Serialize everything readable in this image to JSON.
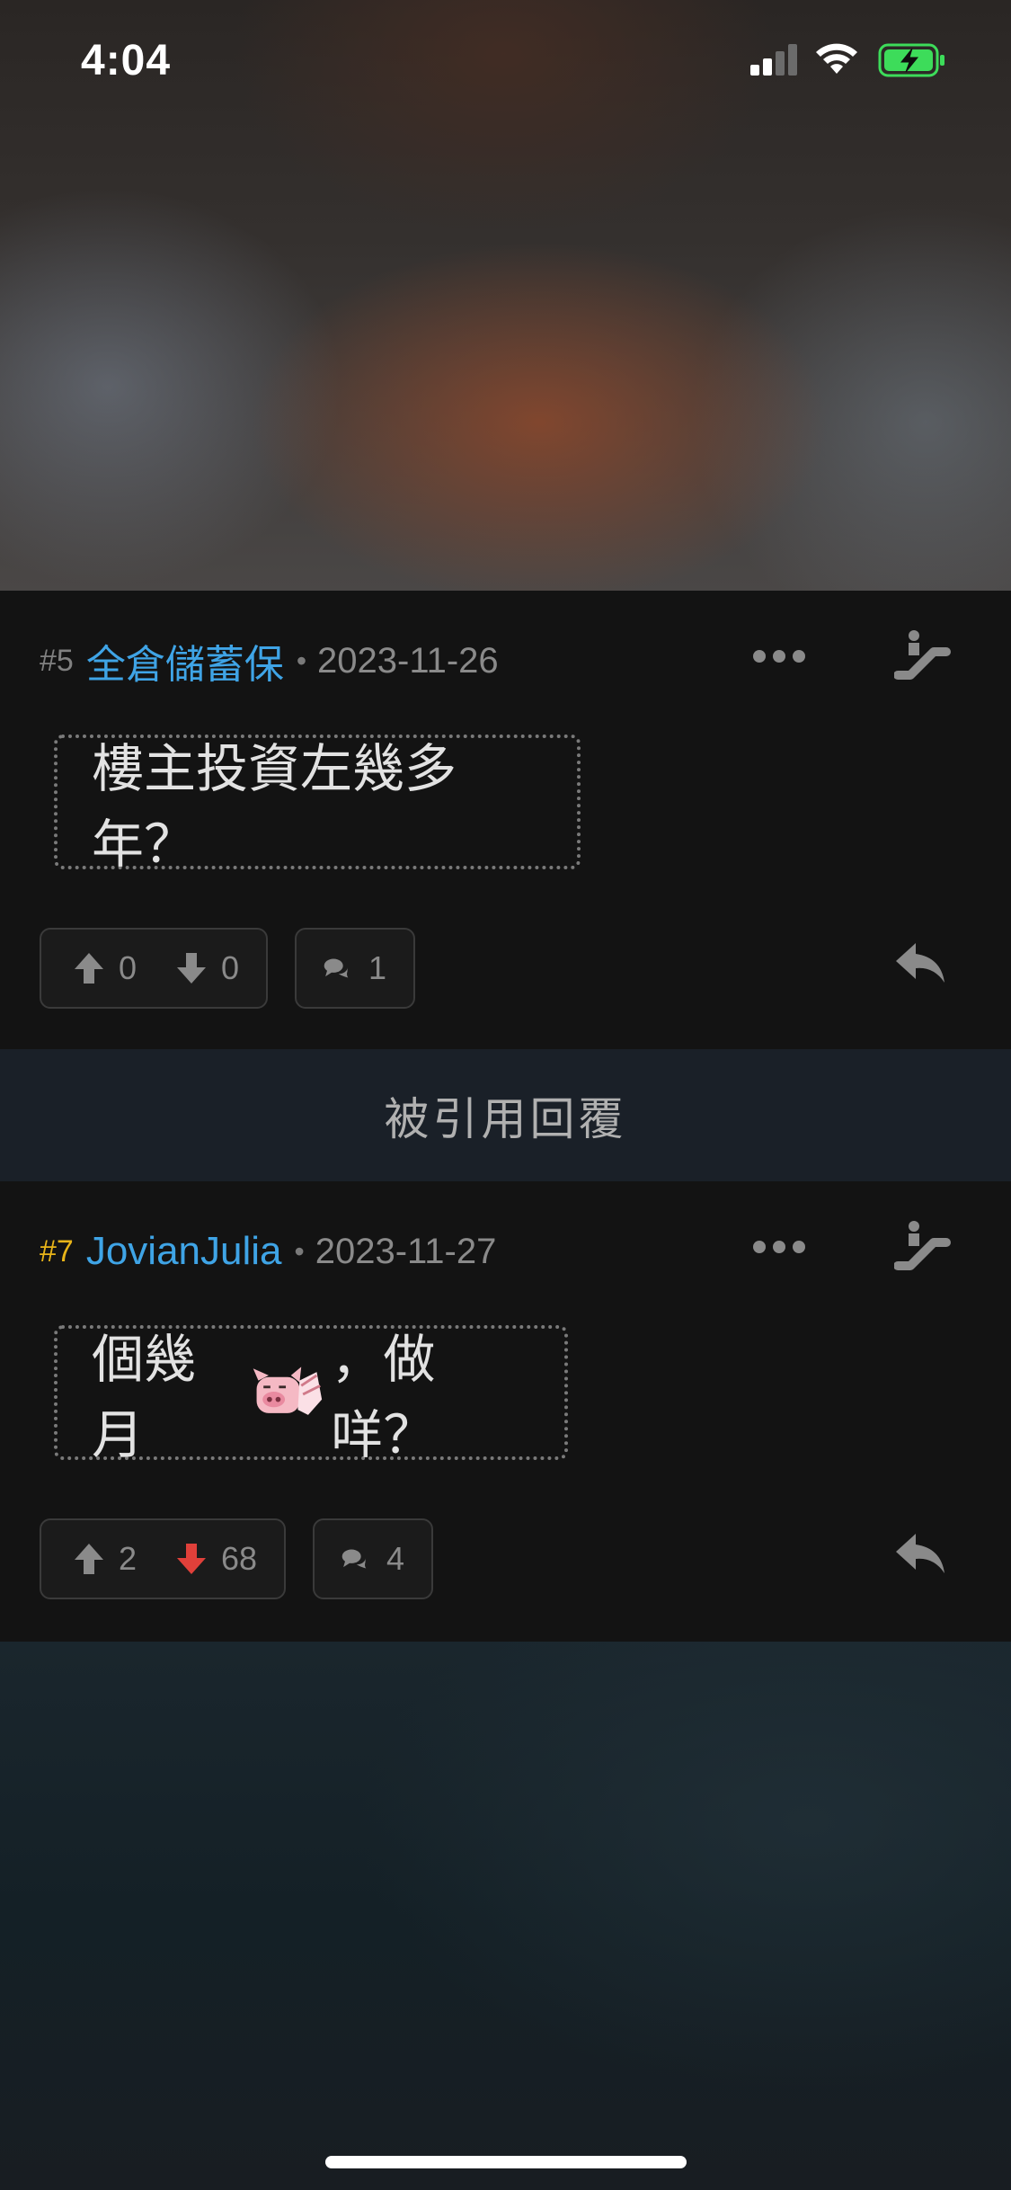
{
  "status_bar": {
    "time": "4:04"
  },
  "posts": [
    {
      "number": "#5",
      "username": "全倉儲蓄保",
      "date": "2023-11-26",
      "content": "樓主投資左幾多年？",
      "upvotes": "0",
      "downvotes": "0",
      "replies": "1"
    },
    {
      "number": "#7",
      "username": "JovianJulia",
      "date": "2023-11-27",
      "content_before_emoji": "個幾月",
      "content_after_emoji": "，做咩？",
      "upvotes": "2",
      "downvotes": "68",
      "replies": "4"
    }
  ],
  "quoted_section": {
    "label": "被引用回覆"
  },
  "colors": {
    "username": "#3fa4e6",
    "highlight_number": "#e8b419",
    "downvote_active": "#e0403a",
    "icon_gray": "#8a8a8a"
  },
  "icons": [
    "signal-icon",
    "wifi-icon",
    "battery-charging-icon",
    "more-icon",
    "escalator-icon",
    "upvote-icon",
    "downvote-icon",
    "comments-icon",
    "reply-icon",
    "pig-emoji"
  ]
}
